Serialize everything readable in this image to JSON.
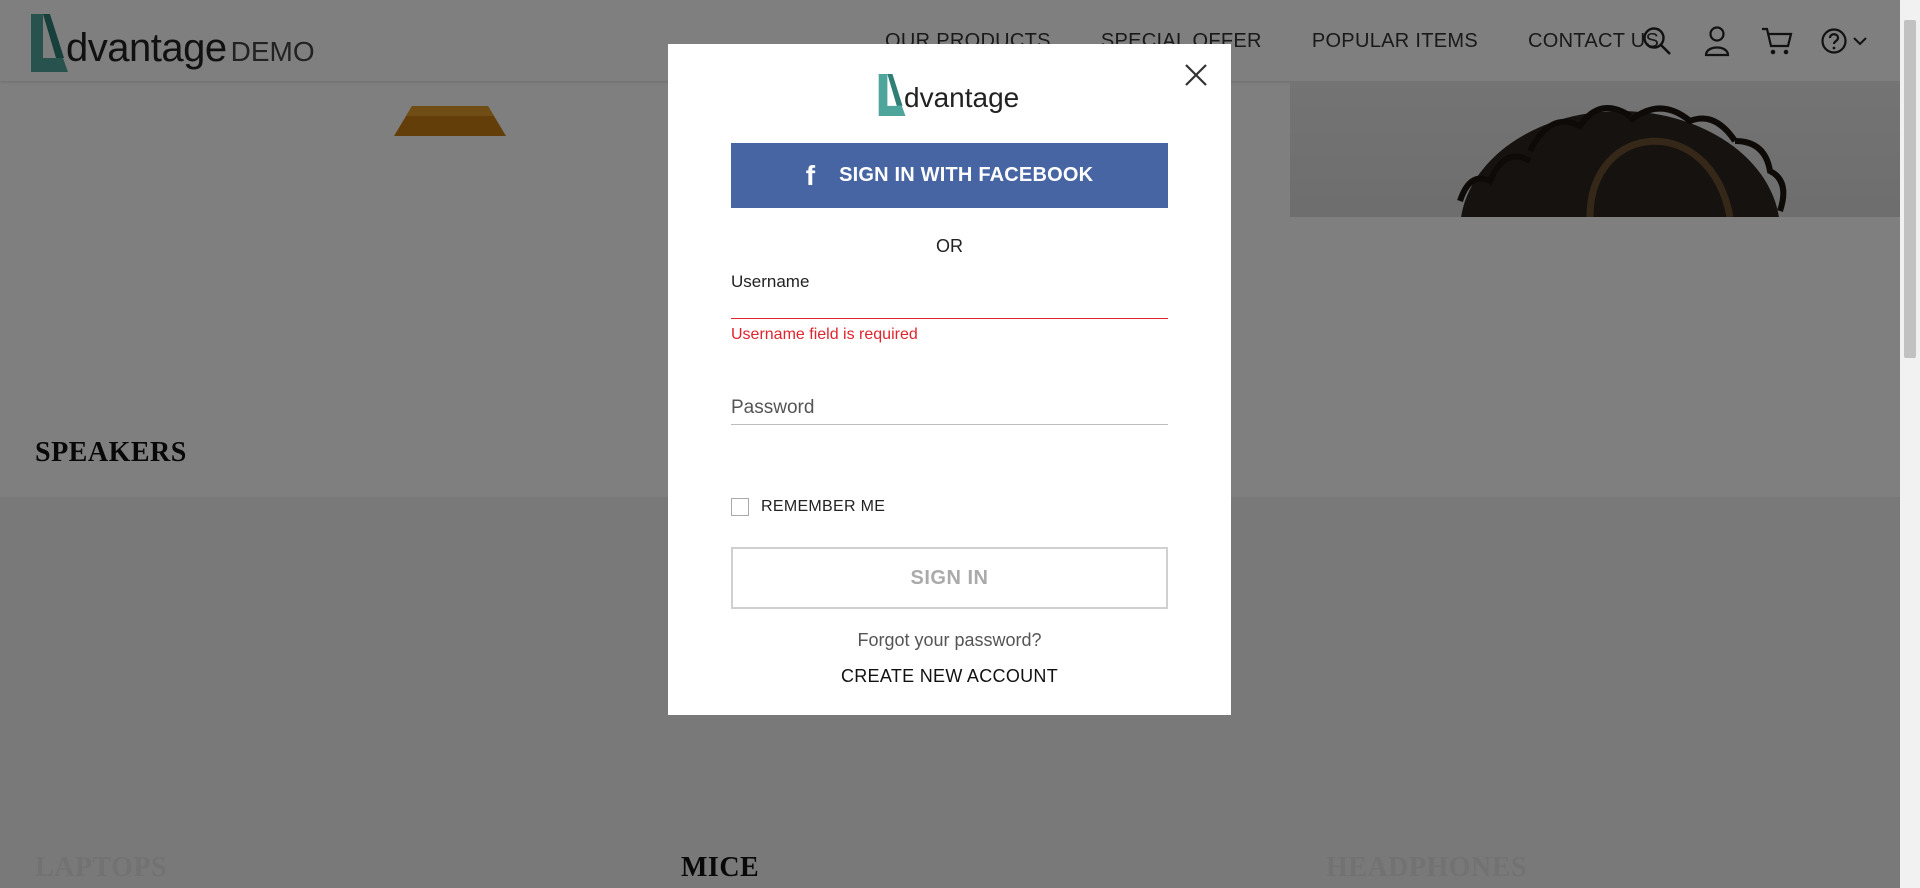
{
  "header": {
    "logo_word": "dvantage",
    "logo_demo": "DEMO",
    "nav": [
      "OUR PRODUCTS",
      "SPECIAL OFFER",
      "POPULAR ITEMS",
      "CONTACT US"
    ],
    "icons": [
      "search-icon",
      "user-icon",
      "cart-icon",
      "help-icon",
      "chevron-down-icon"
    ]
  },
  "categories": {
    "speakers": "SPEAKERS",
    "laptops": "LAPTOPS",
    "mice": "MICE",
    "headphones": "HEADPHONES"
  },
  "login_modal": {
    "logo_word": "dvantage",
    "facebook_label": "SIGN IN WITH FACEBOOK",
    "facebook_icon": "f",
    "or_text": "OR",
    "username_label": "Username",
    "username_value": "",
    "username_error": "Username field is required",
    "password_placeholder": "Password",
    "remember_label": "REMEMBER ME",
    "remember_checked": false,
    "signin_label": "SIGN IN",
    "forgot_label": "Forgot your password?",
    "create_label": "CREATE NEW ACCOUNT"
  },
  "colors": {
    "brand_teal": "#4ea59b",
    "facebook_blue": "#4665a2",
    "error_red": "#e0242e",
    "overlay": "rgba(0,0,0,0.5)"
  }
}
